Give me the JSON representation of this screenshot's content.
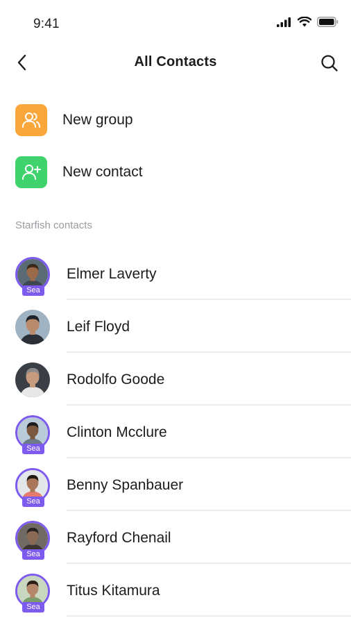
{
  "status_bar": {
    "time": "9:41"
  },
  "header": {
    "title": "All Contacts"
  },
  "actions": [
    {
      "label": "New group",
      "icon": "group-icon",
      "color": "#f9a63b"
    },
    {
      "label": "New contact",
      "icon": "add-user-icon",
      "color": "#3fd26d"
    }
  ],
  "section": {
    "title": "Starfish contacts"
  },
  "badge_label": "Sea",
  "contacts": [
    {
      "name": "Elmer Laverty",
      "badge": true,
      "skin": "#9a6a4a",
      "hair": "#3a2a1c",
      "bg": "#5a6b75",
      "shirt": "#3f4650"
    },
    {
      "name": "Leif Floyd",
      "badge": false,
      "skin": "#b98b6c",
      "hair": "#20242a",
      "bg": "#9fb3c2",
      "shirt": "#2b3038"
    },
    {
      "name": "Rodolfo Goode",
      "badge": false,
      "skin": "#c79b7d",
      "hair": "#8a8a8a",
      "bg": "#3a3f45",
      "shirt": "#e8e8e8"
    },
    {
      "name": "Clinton Mcclure",
      "badge": true,
      "skin": "#7b5840",
      "hair": "#1d1d1d",
      "bg": "#b9cbd8",
      "shirt": "#6c7c8a"
    },
    {
      "name": "Benny Spanbauer",
      "badge": true,
      "skin": "#a9765a",
      "hair": "#1f1712",
      "bg": "#e4e7ea",
      "shirt": "#e57b6f"
    },
    {
      "name": "Rayford Chenail",
      "badge": true,
      "skin": "#8a6a55",
      "hair": "#2a2522",
      "bg": "#6f6a64",
      "shirt": "#3a3530"
    },
    {
      "name": "Titus Kitamura",
      "badge": true,
      "skin": "#b5876a",
      "hair": "#2b1f17",
      "bg": "#c9d6c0",
      "shirt": "#7a9b6a"
    }
  ]
}
